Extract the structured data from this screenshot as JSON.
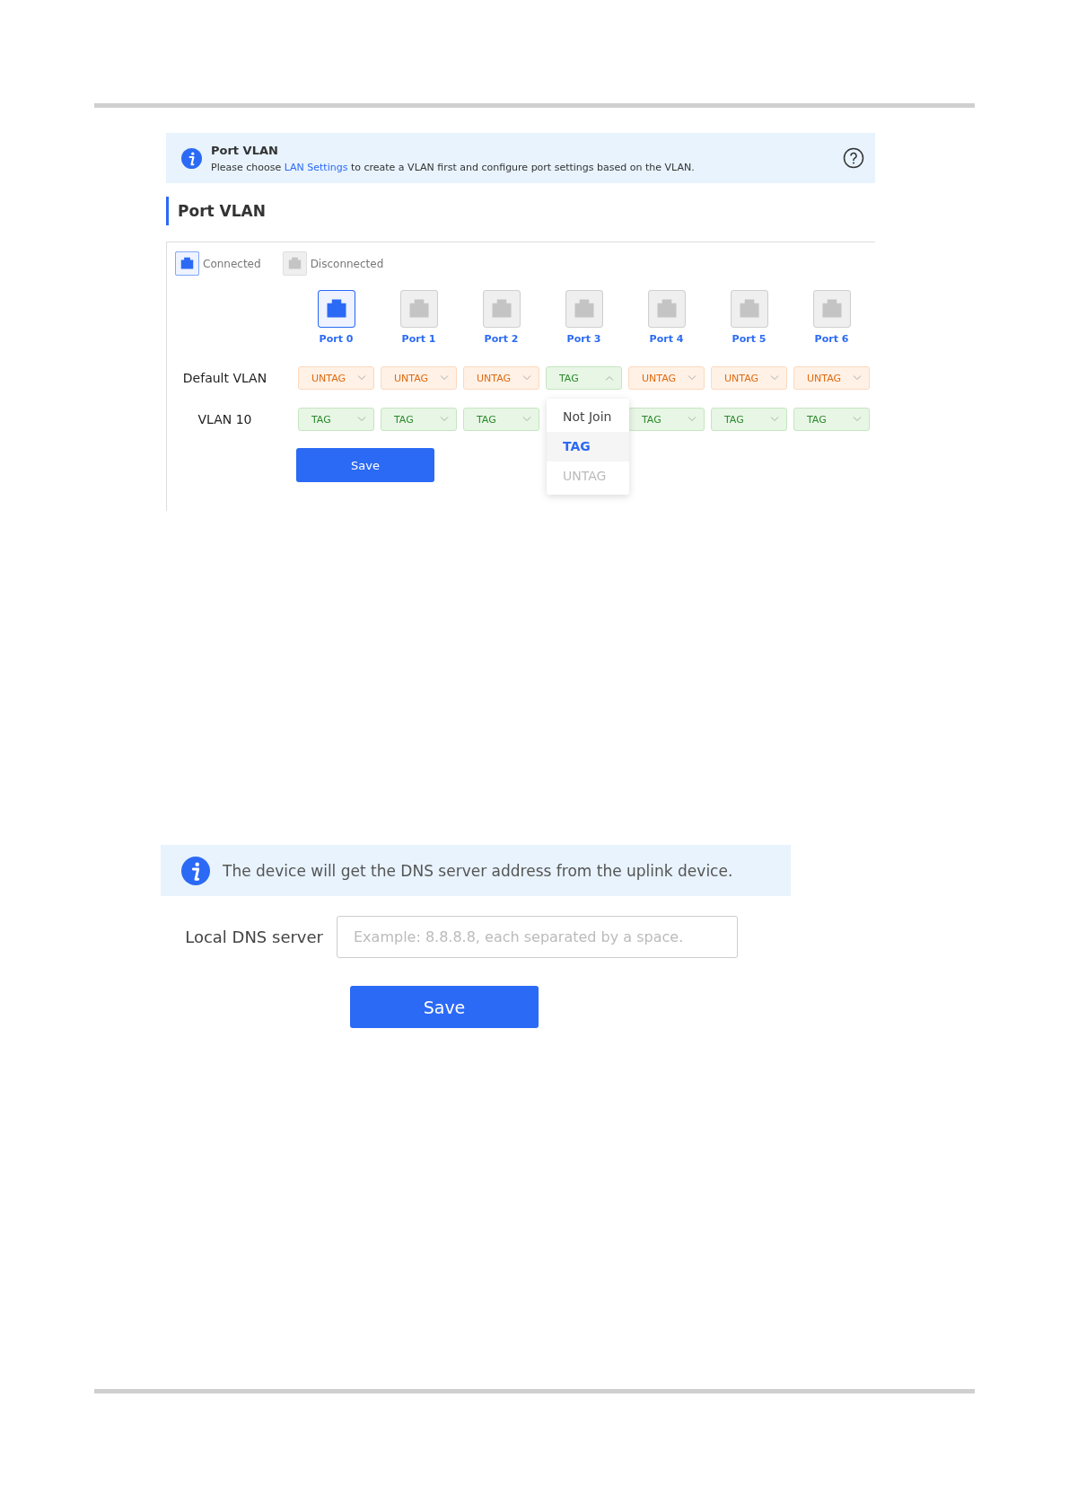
{
  "port_vlan_panel": {
    "notice": {
      "title": "Port VLAN",
      "text_before": "Please choose ",
      "link": "LAN Settings",
      "text_after": " to create a VLAN first and configure port settings based on the VLAN."
    },
    "section_title": "Port VLAN",
    "legend": [
      {
        "kind": "connected",
        "label": "Connected"
      },
      {
        "kind": "disconnected",
        "label": "Disconnected"
      }
    ],
    "ports": [
      {
        "label": "Port 0",
        "connected": true
      },
      {
        "label": "Port 1",
        "connected": false
      },
      {
        "label": "Port 2",
        "connected": false
      },
      {
        "label": "Port 3",
        "connected": false
      },
      {
        "label": "Port 4",
        "connected": false
      },
      {
        "label": "Port 5",
        "connected": false
      },
      {
        "label": "Port 6",
        "connected": false
      }
    ],
    "vlans": [
      {
        "name": "Default VLAN",
        "cells": [
          {
            "kind": "untag",
            "value": "UNTAG",
            "expanded": false
          },
          {
            "kind": "untag",
            "value": "UNTAG",
            "expanded": false
          },
          {
            "kind": "untag",
            "value": "UNTAG",
            "expanded": false
          },
          {
            "kind": "tag",
            "value": "TAG",
            "expanded": true,
            "options": [
              {
                "label": "Not Join",
                "selected": false,
                "disabled": false
              },
              {
                "label": "TAG",
                "selected": true,
                "disabled": false
              },
              {
                "label": "UNTAG",
                "selected": false,
                "disabled": true
              }
            ]
          },
          {
            "kind": "untag",
            "value": "UNTAG",
            "expanded": false
          },
          {
            "kind": "untag",
            "value": "UNTAG",
            "expanded": false
          },
          {
            "kind": "untag",
            "value": "UNTAG",
            "expanded": false
          }
        ]
      },
      {
        "name": "VLAN 10",
        "cells": [
          {
            "kind": "tag",
            "value": "TAG",
            "expanded": false
          },
          {
            "kind": "tag",
            "value": "TAG",
            "expanded": false
          },
          {
            "kind": "tag",
            "value": "TAG",
            "expanded": false
          },
          {
            "kind": "covered"
          },
          {
            "kind": "tag",
            "value": "TAG",
            "expanded": false
          },
          {
            "kind": "tag",
            "value": "TAG",
            "expanded": false
          },
          {
            "kind": "tag",
            "value": "TAG",
            "expanded": false
          }
        ]
      }
    ],
    "save_button": "Save"
  },
  "dns_panel": {
    "notice": "The device will get the DNS server address from the uplink device.",
    "field_label": "Local DNS server",
    "field_placeholder": "Example: 8.8.8.8, each separated by a space.",
    "save_button": "Save"
  }
}
